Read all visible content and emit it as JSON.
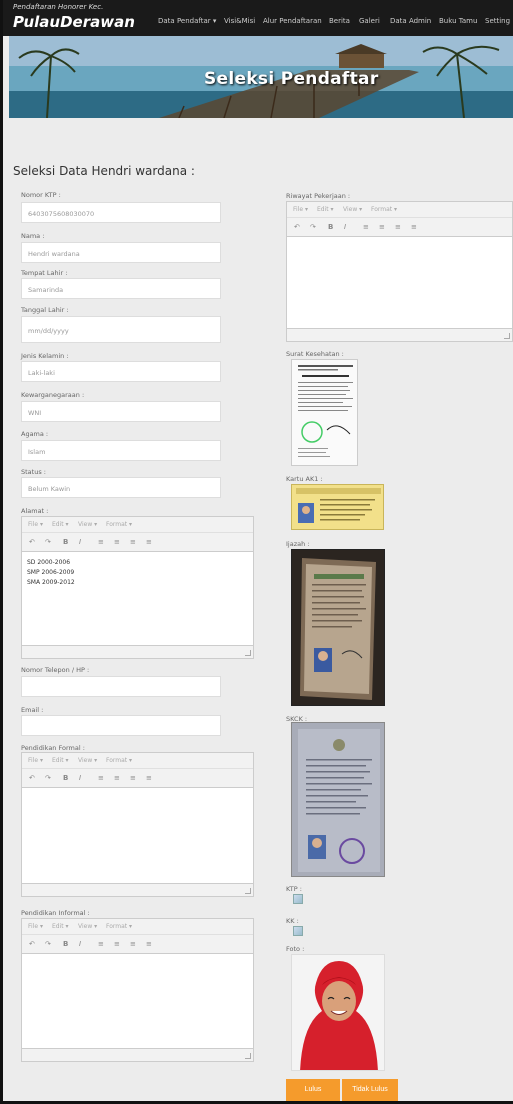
{
  "header": {
    "brand_top": "Pendaftaran Honorer Kec.",
    "brand_main": "PulauDerawan",
    "nav": [
      {
        "label": "Data Pendaftar ▾"
      },
      {
        "label": "Visi&Misi"
      },
      {
        "label": "Alur Pendaftaran"
      },
      {
        "label": "Berita"
      },
      {
        "label": "Galeri"
      },
      {
        "label": "Data Admin"
      },
      {
        "label": "Buku Tamu"
      },
      {
        "label": "Setting"
      }
    ]
  },
  "banner": {
    "title": "Seleksi Pendaftar"
  },
  "page": {
    "heading": "Seleksi Data Hendri wardana :"
  },
  "form": {
    "ktp": {
      "label": "Nomor KTP :",
      "value": "6403075608030070"
    },
    "nama": {
      "label": "Nama :",
      "value": "Hendri wardana"
    },
    "tempat_lahir": {
      "label": "Tempat Lahir :",
      "value": "Samarinda"
    },
    "tanggal_lahir": {
      "label": "Tanggal Lahir :",
      "placeholder": "mm/dd/yyyy"
    },
    "jenis_kelamin": {
      "label": "Jenis Kelamin :",
      "value": "Laki-laki"
    },
    "kewarganegaraan": {
      "label": "Kewarganegaraan :",
      "value": "WNI"
    },
    "agama": {
      "label": "Agama :",
      "value": "Islam"
    },
    "status": {
      "label": "Status :",
      "value": "Belum Kawin"
    },
    "alamat": {
      "label": "Alamat :",
      "lines": [
        "SD 2000-2006",
        "SMP 2006-2009",
        "SMA 2009-2012"
      ]
    },
    "telepon": {
      "label": "Nomor Telepon / HP :",
      "value": ""
    },
    "email": {
      "label": "Email :",
      "value": ""
    },
    "pendidikan_formal": {
      "label": "Pendidikan Formal :"
    },
    "pendidikan_informal": {
      "label": "Pendidikan Informal :"
    },
    "riwayat": {
      "label": "Riwayat Pekerjaan :"
    }
  },
  "editor": {
    "menus": [
      "File ▾",
      "Edit ▾",
      "View ▾",
      "Format ▾"
    ],
    "tools": [
      "↶",
      "↷",
      "B",
      "I",
      "≡",
      "≡",
      "≡",
      "≡"
    ]
  },
  "documents": {
    "surat": {
      "label": "Surat Kesehatan :"
    },
    "ak1": {
      "label": "Kartu AK1 :"
    },
    "ijazah": {
      "label": "Ijazah :"
    },
    "skck": {
      "label": "SKCK :"
    },
    "ktp": {
      "label": "KTP :"
    },
    "kk": {
      "label": "KK :"
    },
    "foto": {
      "label": "Foto :"
    }
  },
  "actions": {
    "lulus": "Lulus",
    "tidak_lulus": "Tidak Lulus"
  }
}
